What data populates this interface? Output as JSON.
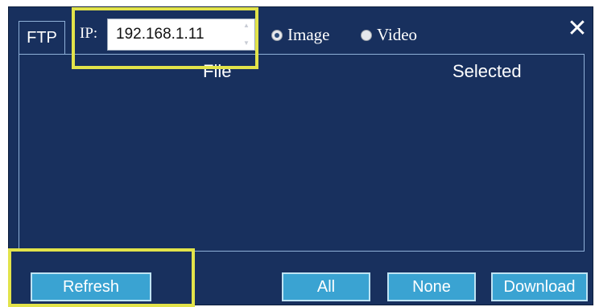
{
  "header": {
    "tab_label": "FTP",
    "ip_label": "IP:",
    "ip_value": "192.168.1.11",
    "radio_image_label": "Image",
    "radio_video_label": "Video",
    "selected_mode": "Image",
    "close_glyph": "✕"
  },
  "list": {
    "columns": [
      "File",
      "Selected"
    ],
    "rows": []
  },
  "footer": {
    "refresh_label": "Refresh",
    "all_label": "All",
    "none_label": "None",
    "download_label": "Download"
  },
  "colors": {
    "window_bg": "#18305e",
    "button_bg": "#3aa3d2",
    "highlight": "#e2e34a"
  }
}
